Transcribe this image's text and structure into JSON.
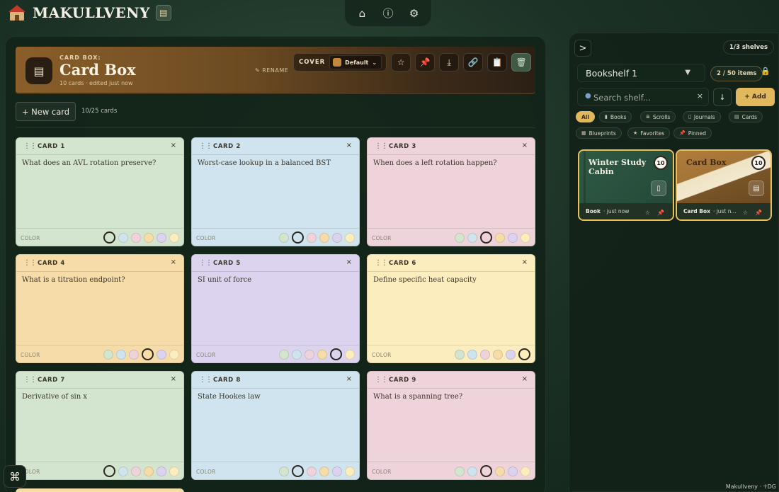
{
  "app": {
    "name": "MAKULLVENY",
    "nav": [
      {
        "name": "home-icon",
        "glyph": "⌂"
      },
      {
        "name": "info-icon",
        "glyph": "ⓘ"
      },
      {
        "name": "gear-icon",
        "glyph": "⚙"
      }
    ],
    "footer": "Makullveny · ☥DG"
  },
  "header": {
    "kicker": "CARD BOX:",
    "title": "Card Box",
    "subtitle": "10 cards · edited just now",
    "rename": "✎ RENAME",
    "cover_label": "COVER",
    "cover_value": "Default",
    "cover_caret": "⌄",
    "icon": "card-box-icon"
  },
  "toolbar": {
    "star": "☆",
    "pin": "📌",
    "download": "⤓",
    "link": "🔗",
    "clipboard": "📋",
    "trash": "🗑"
  },
  "actions": {
    "new_card": "+ New card",
    "count": "10/25 cards"
  },
  "card_ui": {
    "color_label": "COLOR",
    "close": "×",
    "drag": "⋮⋮",
    "swatch_order": [
      "green",
      "blue",
      "pink",
      "orange",
      "purple",
      "yellow"
    ]
  },
  "colors": {
    "green": "#d3e5cf",
    "blue": "#cfe4ee",
    "pink": "#efd3db",
    "orange": "#f6dca9",
    "purple": "#dcd3ef",
    "yellow": "#fbedbe",
    "accent_gold": "#e1b95c"
  },
  "cards": [
    {
      "title": "CARD 1",
      "question": "What does an AVL rotation preserve?",
      "color": "green"
    },
    {
      "title": "CARD 2",
      "question": "Worst-case lookup in a balanced BST",
      "color": "blue"
    },
    {
      "title": "CARD 3",
      "question": "When does a left rotation happen?",
      "color": "pink"
    },
    {
      "title": "CARD 4",
      "question": "What is a titration endpoint?",
      "color": "orange"
    },
    {
      "title": "CARD 5",
      "question": "SI unit of force",
      "color": "purple"
    },
    {
      "title": "CARD 6",
      "question": "Define specific heat capacity",
      "color": "yellow"
    },
    {
      "title": "CARD 7",
      "question": "Derivative of sin x",
      "color": "green"
    },
    {
      "title": "CARD 8",
      "question": "State Hookes law",
      "color": "blue"
    },
    {
      "title": "CARD 9",
      "question": "What is a spanning tree?",
      "color": "pink"
    }
  ],
  "sidebar": {
    "toggle": ">",
    "shelves": "1/3 shelves",
    "shelf_name": "Bookshelf 1",
    "shelf_caret": "▼",
    "items": "2 / 50 items",
    "search_placeholder": "Search shelf...",
    "search_clear": "×",
    "sort": "↓",
    "add": "+ Add",
    "filters": [
      {
        "label": "All",
        "icon": ""
      },
      {
        "label": "Books",
        "icon": "📘"
      },
      {
        "label": "Scrolls",
        "icon": "📜"
      },
      {
        "label": "Journals",
        "icon": "📓"
      },
      {
        "label": "Cards",
        "icon": "🗃"
      },
      {
        "label": "Blueprints",
        "icon": "🗺"
      },
      {
        "label": "Favorites",
        "icon": "★"
      },
      {
        "label": "Pinned",
        "icon": "📌"
      }
    ],
    "tiles": [
      {
        "title": "Winter Study Cabin",
        "count": "10",
        "type": "Book",
        "time": "· just now",
        "icon": "book-icon"
      },
      {
        "title": "Card Box",
        "count": "10",
        "type": "Card Box",
        "time": "· just n...",
        "icon": "card-box-icon"
      }
    ]
  }
}
